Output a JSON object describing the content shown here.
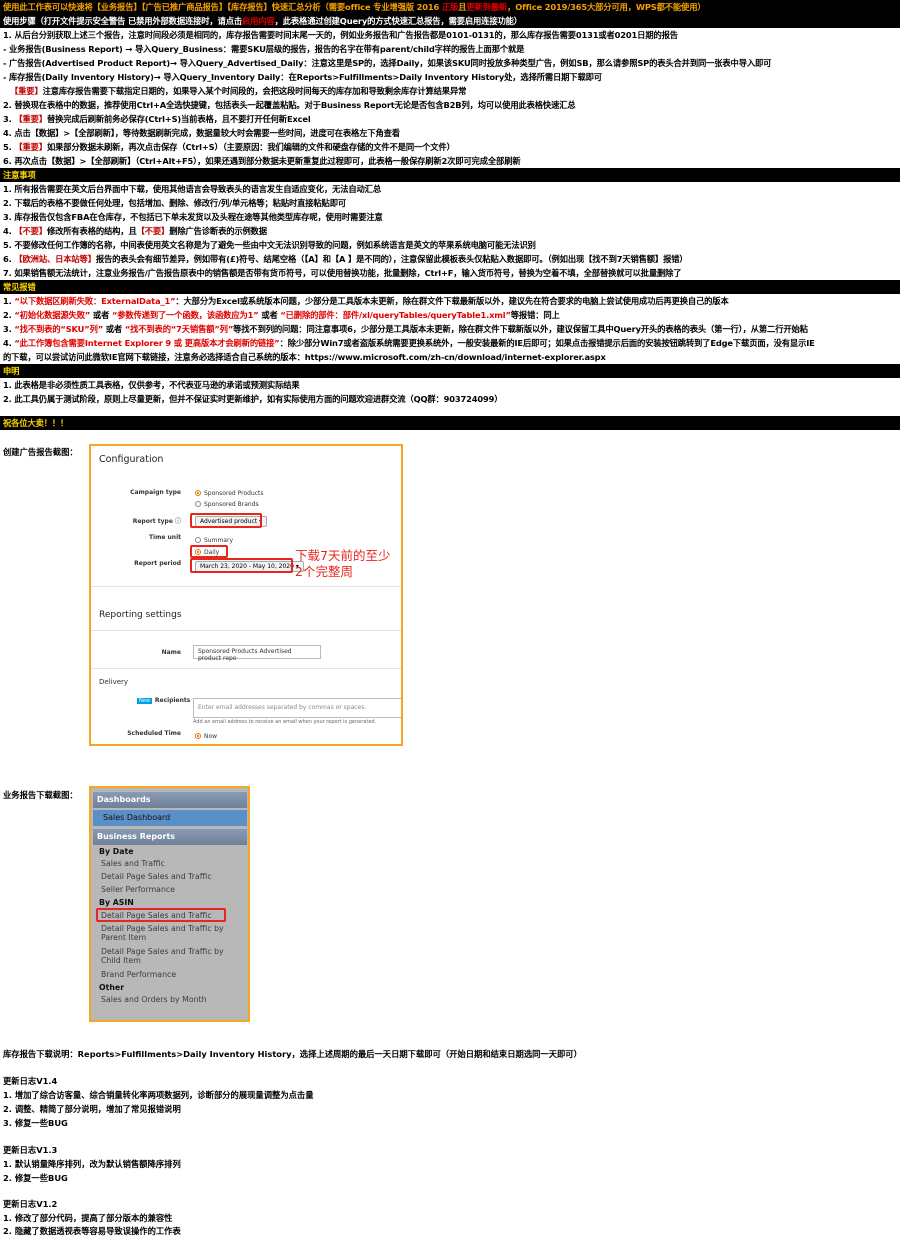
{
  "header": {
    "r1_a": "使用此工作表可以快速将【业务报告】【广告已推广商品报告】【库存报告】快速汇总分析（需要office 专业增强版 2016 ",
    "r1_b": "正版",
    "r1_c": "且",
    "r1_d": "更新到最新",
    "r1_e": "，Office 2019/365大部分可用，WPS都不能使用）",
    "r2_a": "使用步骤（打开文件提示安全警告 已禁用外部数据连接时，请点击",
    "r2_b": "启用内容",
    "r2_c": "，此表格通过创建Query的方式快速汇总报告，需要启用连接功能）"
  },
  "steps": {
    "s1": "1. 从后台分别获取上述三个报告，注意时间段必须是相同的，库存报告需要时间末尾一天的，例如业务报告和广告报告都是0101-0131的，那么库存报告需要0131或者0201日期的报告",
    "s1a": "- 业务报告(Business Report) → 导入Query_Business：需要SKU层级的报告，报告的名字在带有parent/child字样的报告上面那个就是",
    "s1b": "- 广告报告(Advertised Product Report)→ 导入Query_Advertised_Daily：注意这里是SP的，选择Daily，如果该SKU同时投放多种类型广告，例如SB，那么请参照SP的表头合并到同一张表中导入即可",
    "s1c": "- 库存报告(Daily Inventory History)→ 导入Query_Inventory Daily：在Reports>Fulfillments>Daily Inventory History处，选择所需日期下载即可",
    "s1d_a": "【重要】",
    "s1d_b": "注意库存报告需要下载指定日期的，如果导入某个时间段的，会把这段时间每天的库存加和导致剩余库存计算结果异常",
    "s2": "2. 替换现在表格中的数据，推荐使用Ctrl+A全选快捷键，包括表头一起覆盖粘贴。对于Business Report无论是否包含B2B列，均可以使用此表格快速汇总",
    "s3_a": "3. ",
    "s3_b": "【重要】",
    "s3_c": "替换完成后刷新前务必保存(Ctrl+S)当前表格，且不要打开任何新Excel",
    "s4": "4. 点击【数据】>【全部刷新】，等待数据刷新完成，数据量较大时会需要一些时间，进度可在表格左下角查看",
    "s5_a": "5. ",
    "s5_b": "【重要】",
    "s5_c": "如果部分数据未刷新，再次点击保存（Ctrl+S）（主要原因：我们编辑的文件和硬盘存储的文件不是同一个文件）",
    "s6": "6. 再次点击【数据】>【全部刷新】（Ctrl+Alt+F5），如果还遇到部分数据未更新重复此过程即可，此表格一般保存刷新2次即可完成全部刷新"
  },
  "notes": {
    "title": "注意事项",
    "n1": "1. 所有报告需要在英文后台界面中下载，使用其他语言会导致表头的语言发生自适应变化，无法自动汇总",
    "n2": "2. 下载后的表格不要做任何处理，包括增加、删除、修改行/列/单元格等；粘贴时直接粘贴即可",
    "n3": "3. 库存报告仅包含FBA在仓库存，不包括已下单未发货以及头程在途等其他类型库存呢，使用时需要注意",
    "n4_a": "4. ",
    "n4_b": "【不要】",
    "n4_c": "修改所有表格的结构，且",
    "n4_d": "【不要】",
    "n4_e": "删除广告诊断表的示例数据",
    "n5": "5. 不要修改任何工作簿的名称，中间表使用英文名称是为了避免一些由中文无法识别导致的问题，例如系统语言是英文的苹果系统电脑可能无法识别",
    "n6_a": "6. ",
    "n6_b": "【欧洲站、日本站等】",
    "n6_c": "报告的表头会有细节差异，例如带有(£)符号、结尾空格（【A】和【A 】是不同的），注意保留此模板表头仅粘贴入数据即可。（例如出现【找不到7天销售额】报错）",
    "n7": "7. 如果销售额无法统计，注意业务报告/广告报告原表中的销售额是否带有货币符号，可以使用替换功能，批量删除，Ctrl+F，输入货币符号，替换为空着不填，全部替换就可以批量删除了"
  },
  "errors": {
    "title": "常见报错",
    "e1_a": "1. ",
    "e1_b": "“以下数据区刷新失败：ExternalData_1”",
    "e1_c": "：大部分为Excel或系统版本问题，少部分是工具版本未更新，除在群文件下载最新版以外，建议先在符合要求的电脑上尝试使用成功后再更换自己的版本",
    "e2_a": "2. ",
    "e2_b": "“初始化数据源失败”",
    "e2_c": "或者",
    "e2_d": "“参数传递到了一个函数，该函数应为1”",
    "e2_e": "或者",
    "e2_f": "“已删除的部件：部件/xl/queryTables/queryTable1.xml”",
    "e2_g": "等报错：同上",
    "e3_a": "3. ",
    "e3_b": "“找不到表的“SKU”列”",
    "e3_c": "或者",
    "e3_d": "“找不到表的“7天销售额”列”",
    "e3_e": "等找不到列的问题：同注意事项6，少部分是工具版本未更新，除在群文件下载新版以外，建议保留工具中Query开头的表格的表头（第一行），从第二行开始粘",
    "e4_a": "4. ",
    "e4_b": "“此工作簿包含需要Internet Explorer 9 或 更高版本才会刷新的链接”",
    "e4_c": "：除少部分Win7或者盗版系统需要更换系统外，一般安装最新的IE后即可；如果点击报错提示后面的安装按钮跳转到了Edge下载页面，没有显示IE",
    "e4_d": "的下载，可以尝试访问此微软IE官网下载链接，注意务必选择适合自己系统的版本：https://www.microsoft.com/zh-cn/download/internet-explorer.aspx"
  },
  "disclaimer": {
    "title": "申明",
    "d1": "1. 此表格是非必须性质工具表格，仅供参考，不代表亚马逊的承诺或预测实际结果",
    "d2": "2. 此工具仍属于测试阶段，原则上尽量更新，但并不保证实时更新维护，如有实际使用方面的问题欢迎进群交流（QQ群：903724099）"
  },
  "wish": "祝各位大卖！！！",
  "ad_label": "创建广告报告截图：",
  "config": {
    "title": "Configuration",
    "campaign_type_label": "Campaign type",
    "opt_sp": "Sponsored Products",
    "opt_sb": "Sponsored Brands",
    "report_type_label": "Report type",
    "report_type_value": "Advertised product",
    "time_unit_label": "Time unit",
    "opt_summary": "Summary",
    "opt_daily": "Daily",
    "report_period_label": "Report period",
    "report_period_value": "March 23, 2020 - May 10, 2020",
    "note_line1": "下载7天前的至少",
    "note_line2": "2个完整周",
    "reporting_title": "Reporting settings",
    "name_label": "Name",
    "name_value": "Sponsored Products Advertised product repo",
    "delivery_title": "Delivery",
    "new_badge": "New",
    "recipients_label": "Recipients",
    "recipients_placeholder": "Enter email addresses separated by commas or spaces.",
    "recipients_help": "Add an email address to receive an email when your report is generated.",
    "scheduled_label": "Scheduled Time",
    "opt_now": "Now"
  },
  "business_label": "业务报告下载截图：",
  "business": {
    "dashboards": "Dashboards",
    "sales_dashboard": "Sales Dashboard",
    "business_reports": "Business Reports",
    "by_date": "By Date",
    "items_date": [
      "Sales and Traffic",
      "Detail Page Sales and Traffic",
      "Seller Performance"
    ],
    "by_asin": "By ASIN",
    "asin_1": "Detail Page Sales and Traffic",
    "asin_2a": "Detail Page Sales and Traffic by",
    "asin_2b": "Parent Item",
    "asin_3a": "Detail Page Sales and Traffic by",
    "asin_3b": "Child Item",
    "asin_4": "Brand Performance",
    "other": "Other",
    "other_1": "Sales and Orders by Month"
  },
  "inventory_note": "库存报告下载说明：Reports>Fulfillments>Daily Inventory History，选择上述周期的最后一天日期下载即可（开始日期和结束日期选同一天即可）",
  "changelog": {
    "v14_title": "更新日志V1.4",
    "v14_1": "1. 增加了综合访客量、综合销量转化率两项数据列，诊断部分的展现量调整为点击量",
    "v14_2": "2. 调整、精简了部分说明，增加了常见报错说明",
    "v14_3": "3. 修复一些BUG",
    "v13_title": "更新日志V1.3",
    "v13_1": "1. 默认销量降序排列，改为默认销售额降序排列",
    "v13_2": "2. 修复一些BUG",
    "v12_title": "更新日志V1.2",
    "v12_1": "1. 修改了部分代码，提高了部分版本的兼容性",
    "v12_2": "2. 隐藏了数据透视表等容易导致误操作的工作表"
  }
}
